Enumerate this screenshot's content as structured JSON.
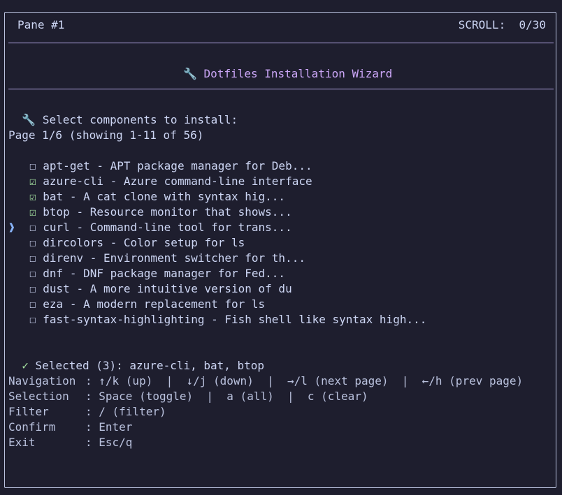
{
  "pane": {
    "title": "Pane #1",
    "scroll_label": "SCROLL:",
    "scroll_value": "0/30"
  },
  "header": {
    "icon": "wrench-icon",
    "title": "Dotfiles Installation Wizard"
  },
  "prompt": {
    "icon": "wrench-icon",
    "text": "Select components to install:"
  },
  "page_info": "Page 1/6 (showing 1-11 of 56)",
  "components": [
    {
      "label": "apt-get - APT package manager for Deb...",
      "checked": false,
      "cursor": false
    },
    {
      "label": "azure-cli - Azure command-line interface",
      "checked": true,
      "cursor": false
    },
    {
      "label": "bat - A cat clone with syntax hig...",
      "checked": true,
      "cursor": false
    },
    {
      "label": "btop - Resource monitor that shows...",
      "checked": true,
      "cursor": false
    },
    {
      "label": "curl - Command-line tool for trans...",
      "checked": false,
      "cursor": true
    },
    {
      "label": "dircolors - Color setup for ls",
      "checked": false,
      "cursor": false
    },
    {
      "label": "direnv - Environment switcher for th...",
      "checked": false,
      "cursor": false
    },
    {
      "label": "dnf - DNF package manager for Fed...",
      "checked": false,
      "cursor": false
    },
    {
      "label": "dust - A more intuitive version of du",
      "checked": false,
      "cursor": false
    },
    {
      "label": "eza - A modern replacement for ls",
      "checked": false,
      "cursor": false
    },
    {
      "label": "fast-syntax-highlighting - Fish shell like syntax high...",
      "checked": false,
      "cursor": false
    }
  ],
  "glyphs": {
    "unchecked": "☐",
    "checked": "☑",
    "cursor": "❱",
    "selected_check": "✓",
    "wrench": "🔧"
  },
  "selected": {
    "text": "Selected (3): azure-cli, bat, btop"
  },
  "help": [
    {
      "key": "Navigation",
      "value": ": ↑/k (up)  |  ↓/j (down)  |  →/l (next page)  |  ←/h (prev page)"
    },
    {
      "key": "Selection",
      "value": ": Space (toggle)  |  a (all)  |  c (clear)"
    },
    {
      "key": "Filter",
      "value": ": / (filter)"
    },
    {
      "key": "Confirm",
      "value": ": Enter"
    },
    {
      "key": "Exit",
      "value": ": Esc/q"
    }
  ],
  "colors": {
    "background": "#1e1e2e",
    "text": "#cdd6f4",
    "accent_title": "#cba6f7",
    "checked_green": "#a6e3a1",
    "cursor_blue": "#89b4fa",
    "separator": "#b4a6e6"
  }
}
